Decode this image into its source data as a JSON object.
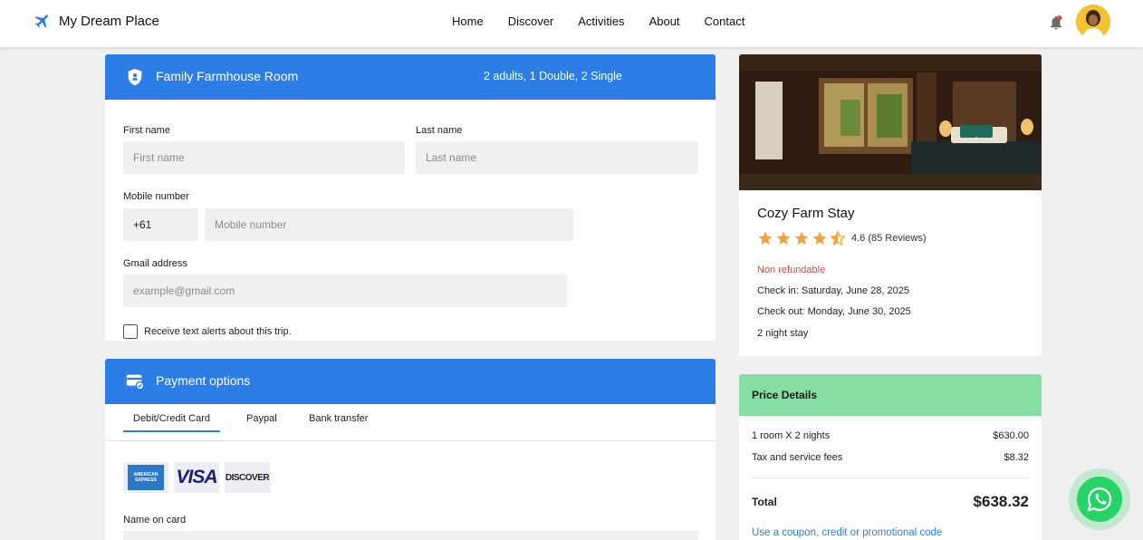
{
  "brand": {
    "name": "My Dream Place",
    "icon": "plane-icon"
  },
  "nav": {
    "items": [
      "Home",
      "Discover",
      "Activities",
      "About",
      "Contact"
    ]
  },
  "room": {
    "title": "Family Farmhouse Room",
    "guests": "2 adults, 1 Double, 2 Single",
    "first_name_label": "First name",
    "first_name_placeholder": "First name",
    "last_name_label": "Last name",
    "last_name_placeholder": "Last name",
    "mobile_label": "Mobile number",
    "country_code": "+61",
    "mobile_placeholder": "Mobile number",
    "email_label": "Gmail address",
    "email_placeholder": "example@gmail.com",
    "alerts_label": "Receive text alerts about this trip."
  },
  "payment": {
    "title": "Payment options",
    "tabs": [
      "Debit/Credit Card",
      "Paypal",
      "Bank transfer"
    ],
    "active_tab": "Debit/Credit Card",
    "cards": [
      "AMERICAN EXPRESS",
      "VISA",
      "DISCOVER"
    ],
    "name_on_card_label": "Name on card"
  },
  "hotel": {
    "name": "Cozy Farm Stay",
    "rating": 4.6,
    "rating_text": "4.6 (85 Reviews)",
    "refund": "Non refundable",
    "check_in": "Check in: Saturday, June 28, 2025",
    "check_out": "Check out: Monday, June 30, 2025",
    "stay": "2 night stay"
  },
  "price": {
    "title": "Price Details",
    "rows": [
      {
        "label": "1 room X 2 nights",
        "amount": "$630.00"
      },
      {
        "label": "Tax and service fees",
        "amount": "$8.32"
      }
    ],
    "total_label": "Total",
    "total_amount": "$638.32",
    "coupon_link": "Use a coupon, credit or promotional code"
  },
  "colors": {
    "primary": "#2c7ee6",
    "price_header": "#86dea4",
    "star": "#f2a23a",
    "refund": "#e0453a",
    "whatsapp": "#25d366"
  }
}
